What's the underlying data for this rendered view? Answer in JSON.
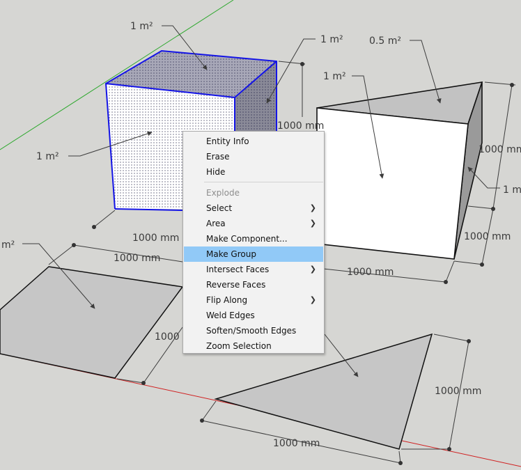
{
  "labels": {
    "cube_top_area": "1 m²",
    "cube_side_area": "1 m²",
    "cube_front_area": "1 m²",
    "cube_height": "1000 mm",
    "cube_width": "1000 mm",
    "prism_top_area": "0.5 m²",
    "prism_front_area": "1 m²",
    "prism_side_area": "1 m",
    "prism_height_right": "1000 mm",
    "prism_depth": "1000 mm",
    "prism_width": "1000 mm",
    "square_area": "m²",
    "square_width": "1000 mm",
    "square_depth": "1000",
    "triangle_height": "1000 mm",
    "triangle_width": "1000 mm"
  },
  "context_menu": {
    "items": [
      {
        "label": "Entity Info",
        "name": "menu-entity-info"
      },
      {
        "label": "Erase",
        "name": "menu-erase"
      },
      {
        "label": "Hide",
        "name": "menu-hide"
      },
      {
        "separator": true
      },
      {
        "label": "Explode",
        "name": "menu-explode",
        "disabled": true
      },
      {
        "label": "Select",
        "name": "menu-select",
        "submenu": true
      },
      {
        "label": "Area",
        "name": "menu-area",
        "submenu": true
      },
      {
        "label": "Make Component...",
        "name": "menu-make-component"
      },
      {
        "label": "Make Group",
        "name": "menu-make-group",
        "highlighted": true
      },
      {
        "label": "Intersect Faces",
        "name": "menu-intersect-faces",
        "submenu": true
      },
      {
        "label": "Reverse Faces",
        "name": "menu-reverse-faces"
      },
      {
        "label": "Flip Along",
        "name": "menu-flip-along",
        "submenu": true
      },
      {
        "label": "Weld Edges",
        "name": "menu-weld-edges"
      },
      {
        "label": "Soften/Smooth Edges",
        "name": "menu-soften-smooth-edges"
      },
      {
        "label": "Zoom Selection",
        "name": "menu-zoom-selection"
      }
    ]
  },
  "colors": {
    "background": "#d6d6d3",
    "selection": "#1414e6",
    "highlight": "#91c9f7",
    "red_axis": "#d02020",
    "green_axis": "#2ea82e"
  }
}
